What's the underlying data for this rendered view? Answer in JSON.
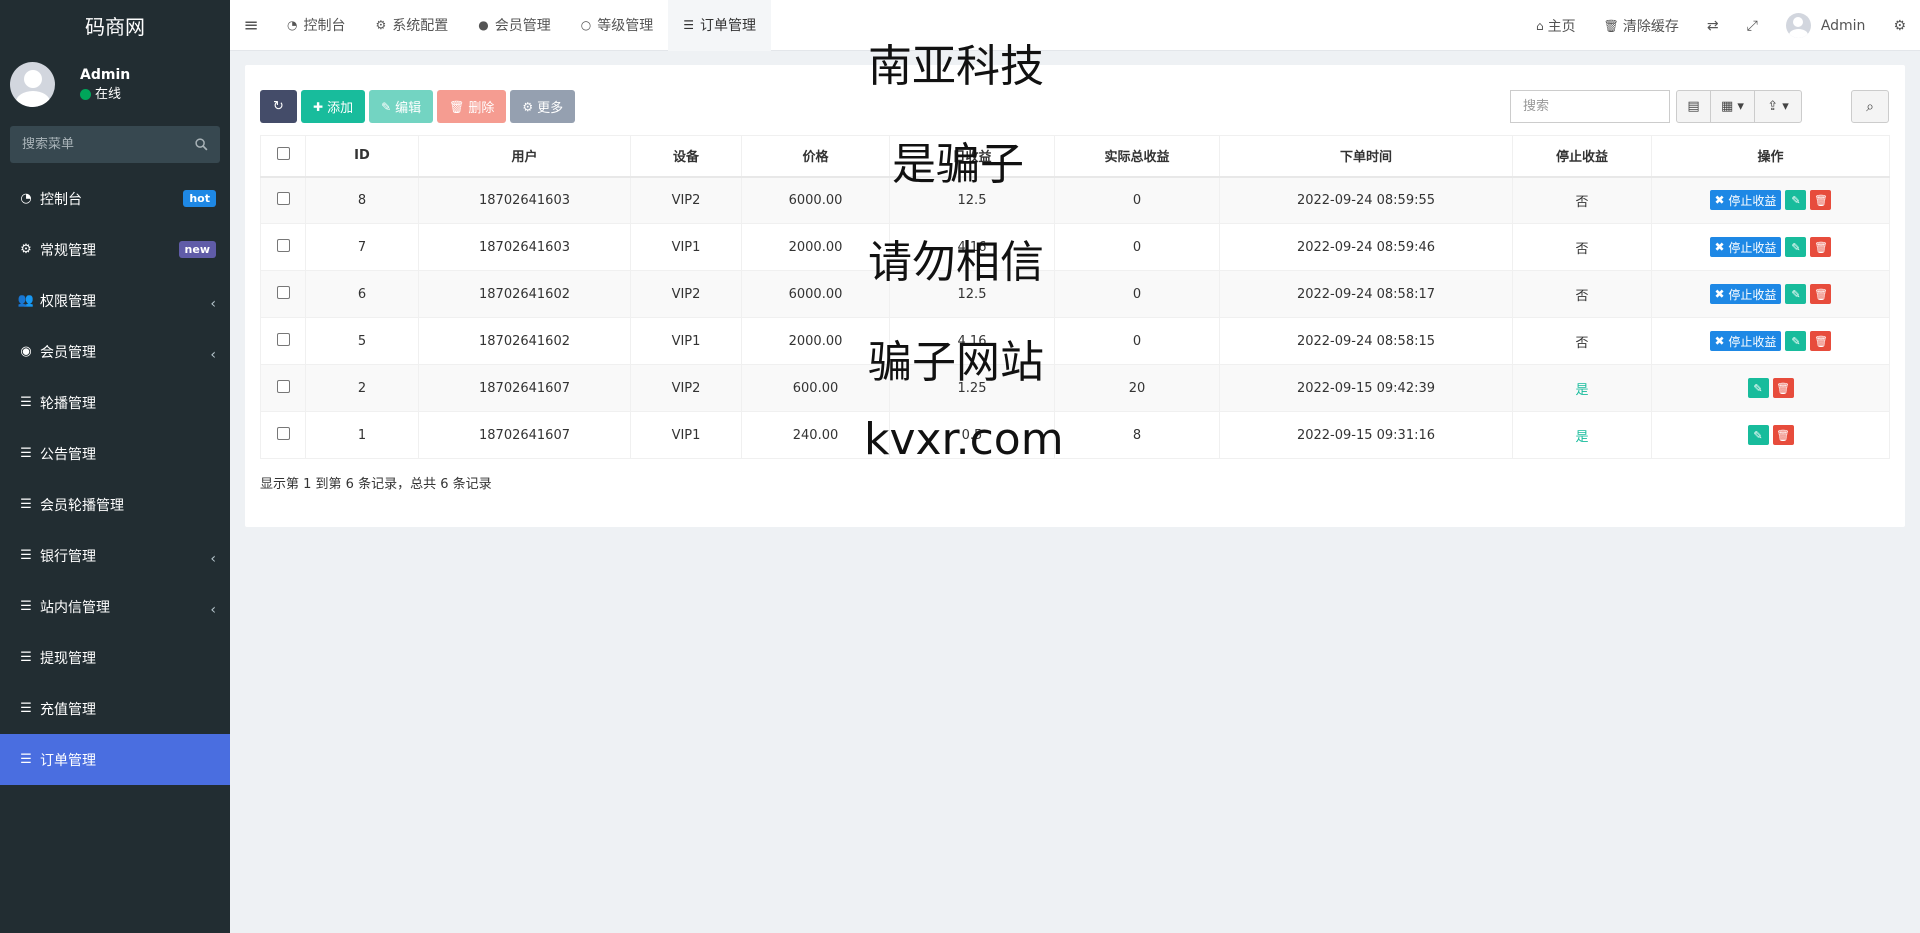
{
  "sidebar": {
    "logo": "码商网",
    "user": {
      "name": "Admin",
      "status": "在线"
    },
    "search_placeholder": "搜索菜单",
    "items": [
      {
        "label": "控制台",
        "badge": "hot"
      },
      {
        "label": "常规管理",
        "badge": "new"
      },
      {
        "label": "权限管理"
      },
      {
        "label": "会员管理"
      },
      {
        "label": "轮播管理"
      },
      {
        "label": "公告管理"
      },
      {
        "label": "会员轮播管理"
      },
      {
        "label": "银行管理"
      },
      {
        "label": "站内信管理"
      },
      {
        "label": "提现管理"
      },
      {
        "label": "充值管理"
      },
      {
        "label": "订单管理"
      }
    ]
  },
  "topnav": {
    "tabs": [
      "控制台",
      "系统配置",
      "会员管理",
      "等级管理",
      "订单管理"
    ],
    "home": "主页",
    "clear_cache": "清除缓存",
    "user": "Admin"
  },
  "toolbar": {
    "add": "添加",
    "edit": "编辑",
    "delete": "删除",
    "more": "更多",
    "search_placeholder": "搜索"
  },
  "table": {
    "headers": [
      "ID",
      "用户",
      "设备",
      "价格",
      "日收益",
      "实际总收益",
      "下单时间",
      "停止收益",
      "操作"
    ],
    "stop_label": "停止收益",
    "rows": [
      {
        "id": "8",
        "user": "18702641603",
        "device": "VIP2",
        "price": "6000.00",
        "daily": "12.5",
        "total": "0",
        "time": "2022-09-24 08:59:55",
        "stopped": "否"
      },
      {
        "id": "7",
        "user": "18702641603",
        "device": "VIP1",
        "price": "2000.00",
        "daily": "4.16",
        "total": "0",
        "time": "2022-09-24 08:59:46",
        "stopped": "否"
      },
      {
        "id": "6",
        "user": "18702641602",
        "device": "VIP2",
        "price": "6000.00",
        "daily": "12.5",
        "total": "0",
        "time": "2022-09-24 08:58:17",
        "stopped": "否"
      },
      {
        "id": "5",
        "user": "18702641602",
        "device": "VIP1",
        "price": "2000.00",
        "daily": "4.16",
        "total": "0",
        "time": "2022-09-24 08:58:15",
        "stopped": "否"
      },
      {
        "id": "2",
        "user": "18702641607",
        "device": "VIP2",
        "price": "600.00",
        "daily": "1.25",
        "total": "20",
        "time": "2022-09-15 09:42:39",
        "stopped": "是"
      },
      {
        "id": "1",
        "user": "18702641607",
        "device": "VIP1",
        "price": "240.00",
        "daily": "0.5",
        "total": "8",
        "time": "2022-09-15 09:31:16",
        "stopped": "是"
      }
    ]
  },
  "pagination": "显示第 1 到第 6 条记录，总共 6 条记录",
  "overlay": [
    "南亚科技",
    "是骗子",
    "请勿相信",
    "骗子网站",
    "kvxr.com"
  ]
}
